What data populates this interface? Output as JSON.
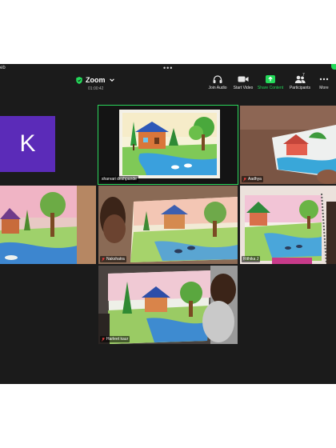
{
  "window": {
    "cut_label": "eb",
    "dots": "•••"
  },
  "meeting": {
    "app_name": "Zoom",
    "timer": "01:00:42"
  },
  "toolbar": [
    {
      "label": "Join Audio",
      "icon": "headphones-icon"
    },
    {
      "label": "Start Video",
      "icon": "video-camera-icon"
    },
    {
      "label": "Share Content",
      "icon": "share-screen-icon"
    },
    {
      "label": "Participants",
      "icon": "participants-icon",
      "count": "7"
    },
    {
      "label": "More",
      "icon": "more-dots-icon"
    }
  ],
  "participants": [
    {
      "name": "",
      "initial": "K",
      "avatar_color": "#5b2bb8"
    },
    {
      "name": "sharvari deshpande",
      "muted": false,
      "active_speaker": true
    },
    {
      "name": "Aadhya",
      "muted": true
    },
    {
      "name": "",
      "muted": false
    },
    {
      "name": "Nakshatra",
      "muted": true
    },
    {
      "name": "Rithika J",
      "muted": false
    },
    {
      "name": "Harleet kaur",
      "muted": true
    }
  ],
  "colors": {
    "accent_green": "#23d959",
    "background": "#1b1b1b",
    "avatar": "#5b2bb8"
  }
}
